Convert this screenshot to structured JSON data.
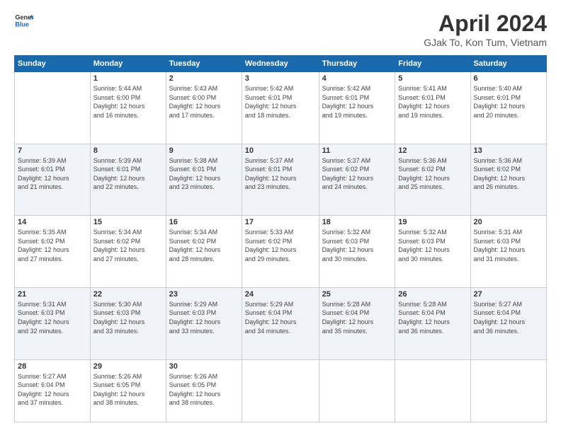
{
  "header": {
    "logo_general": "General",
    "logo_blue": "Blue",
    "title": "April 2024",
    "location": "GJak To, Kon Tum, Vietnam"
  },
  "days_of_week": [
    "Sunday",
    "Monday",
    "Tuesday",
    "Wednesday",
    "Thursday",
    "Friday",
    "Saturday"
  ],
  "weeks": [
    [
      {
        "day": "",
        "info": ""
      },
      {
        "day": "1",
        "info": "Sunrise: 5:44 AM\nSunset: 6:00 PM\nDaylight: 12 hours\nand 16 minutes."
      },
      {
        "day": "2",
        "info": "Sunrise: 5:43 AM\nSunset: 6:00 PM\nDaylight: 12 hours\nand 17 minutes."
      },
      {
        "day": "3",
        "info": "Sunrise: 5:42 AM\nSunset: 6:01 PM\nDaylight: 12 hours\nand 18 minutes."
      },
      {
        "day": "4",
        "info": "Sunrise: 5:42 AM\nSunset: 6:01 PM\nDaylight: 12 hours\nand 19 minutes."
      },
      {
        "day": "5",
        "info": "Sunrise: 5:41 AM\nSunset: 6:01 PM\nDaylight: 12 hours\nand 19 minutes."
      },
      {
        "day": "6",
        "info": "Sunrise: 5:40 AM\nSunset: 6:01 PM\nDaylight: 12 hours\nand 20 minutes."
      }
    ],
    [
      {
        "day": "7",
        "info": "Sunrise: 5:39 AM\nSunset: 6:01 PM\nDaylight: 12 hours\nand 21 minutes."
      },
      {
        "day": "8",
        "info": "Sunrise: 5:39 AM\nSunset: 6:01 PM\nDaylight: 12 hours\nand 22 minutes."
      },
      {
        "day": "9",
        "info": "Sunrise: 5:38 AM\nSunset: 6:01 PM\nDaylight: 12 hours\nand 23 minutes."
      },
      {
        "day": "10",
        "info": "Sunrise: 5:37 AM\nSunset: 6:01 PM\nDaylight: 12 hours\nand 23 minutes."
      },
      {
        "day": "11",
        "info": "Sunrise: 5:37 AM\nSunset: 6:02 PM\nDaylight: 12 hours\nand 24 minutes."
      },
      {
        "day": "12",
        "info": "Sunrise: 5:36 AM\nSunset: 6:02 PM\nDaylight: 12 hours\nand 25 minutes."
      },
      {
        "day": "13",
        "info": "Sunrise: 5:36 AM\nSunset: 6:02 PM\nDaylight: 12 hours\nand 26 minutes."
      }
    ],
    [
      {
        "day": "14",
        "info": "Sunrise: 5:35 AM\nSunset: 6:02 PM\nDaylight: 12 hours\nand 27 minutes."
      },
      {
        "day": "15",
        "info": "Sunrise: 5:34 AM\nSunset: 6:02 PM\nDaylight: 12 hours\nand 27 minutes."
      },
      {
        "day": "16",
        "info": "Sunrise: 5:34 AM\nSunset: 6:02 PM\nDaylight: 12 hours\nand 28 minutes."
      },
      {
        "day": "17",
        "info": "Sunrise: 5:33 AM\nSunset: 6:02 PM\nDaylight: 12 hours\nand 29 minutes."
      },
      {
        "day": "18",
        "info": "Sunrise: 5:32 AM\nSunset: 6:03 PM\nDaylight: 12 hours\nand 30 minutes."
      },
      {
        "day": "19",
        "info": "Sunrise: 5:32 AM\nSunset: 6:03 PM\nDaylight: 12 hours\nand 30 minutes."
      },
      {
        "day": "20",
        "info": "Sunrise: 5:31 AM\nSunset: 6:03 PM\nDaylight: 12 hours\nand 31 minutes."
      }
    ],
    [
      {
        "day": "21",
        "info": "Sunrise: 5:31 AM\nSunset: 6:03 PM\nDaylight: 12 hours\nand 32 minutes."
      },
      {
        "day": "22",
        "info": "Sunrise: 5:30 AM\nSunset: 6:03 PM\nDaylight: 12 hours\nand 33 minutes."
      },
      {
        "day": "23",
        "info": "Sunrise: 5:29 AM\nSunset: 6:03 PM\nDaylight: 12 hours\nand 33 minutes."
      },
      {
        "day": "24",
        "info": "Sunrise: 5:29 AM\nSunset: 6:04 PM\nDaylight: 12 hours\nand 34 minutes."
      },
      {
        "day": "25",
        "info": "Sunrise: 5:28 AM\nSunset: 6:04 PM\nDaylight: 12 hours\nand 35 minutes."
      },
      {
        "day": "26",
        "info": "Sunrise: 5:28 AM\nSunset: 6:04 PM\nDaylight: 12 hours\nand 36 minutes."
      },
      {
        "day": "27",
        "info": "Sunrise: 5:27 AM\nSunset: 6:04 PM\nDaylight: 12 hours\nand 36 minutes."
      }
    ],
    [
      {
        "day": "28",
        "info": "Sunrise: 5:27 AM\nSunset: 6:04 PM\nDaylight: 12 hours\nand 37 minutes."
      },
      {
        "day": "29",
        "info": "Sunrise: 5:26 AM\nSunset: 6:05 PM\nDaylight: 12 hours\nand 38 minutes."
      },
      {
        "day": "30",
        "info": "Sunrise: 5:26 AM\nSunset: 6:05 PM\nDaylight: 12 hours\nand 38 minutes."
      },
      {
        "day": "",
        "info": ""
      },
      {
        "day": "",
        "info": ""
      },
      {
        "day": "",
        "info": ""
      },
      {
        "day": "",
        "info": ""
      }
    ]
  ]
}
